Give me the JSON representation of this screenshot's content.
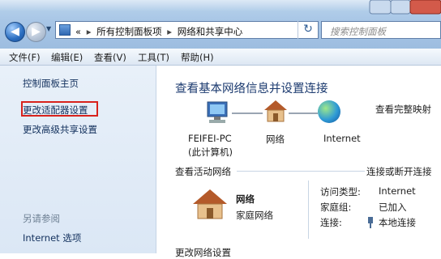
{
  "address": {
    "prefix": "«",
    "crumbs": [
      "所有控制面板项",
      "网络和共享中心"
    ]
  },
  "search": {
    "placeholder": "搜索控制面板"
  },
  "menu": [
    "文件(F)",
    "编辑(E)",
    "查看(V)",
    "工具(T)",
    "帮助(H)"
  ],
  "sidebar": {
    "links": [
      "控制面板主页",
      "更改适配器设置",
      "更改高级共享设置"
    ],
    "see_also_title": "另请参阅",
    "see_also": [
      "Internet 选项"
    ]
  },
  "main": {
    "heading": "查看基本网络信息并设置连接",
    "full_map": "查看完整映射",
    "map": {
      "computer": "FEIFEI-PC",
      "computer_sub": "(此计算机)",
      "network": "网络",
      "internet": "Internet"
    },
    "active_title": "查看活动网络",
    "connect_link": "连接或断开连接",
    "network": {
      "name": "网络",
      "type": "家庭网络"
    },
    "details": {
      "access_label": "访问类型:",
      "access_value": "Internet",
      "homegroup_label": "家庭组:",
      "homegroup_value": "已加入",
      "conn_label": "连接:",
      "conn_value": "本地连接"
    },
    "change_title": "更改网络设置"
  },
  "icons": {
    "computer": "computer-icon",
    "house": "house-icon",
    "globe": "internet-globe-icon",
    "adapter": "network-adapter-icon",
    "control_panel": "control-panel-icon"
  }
}
